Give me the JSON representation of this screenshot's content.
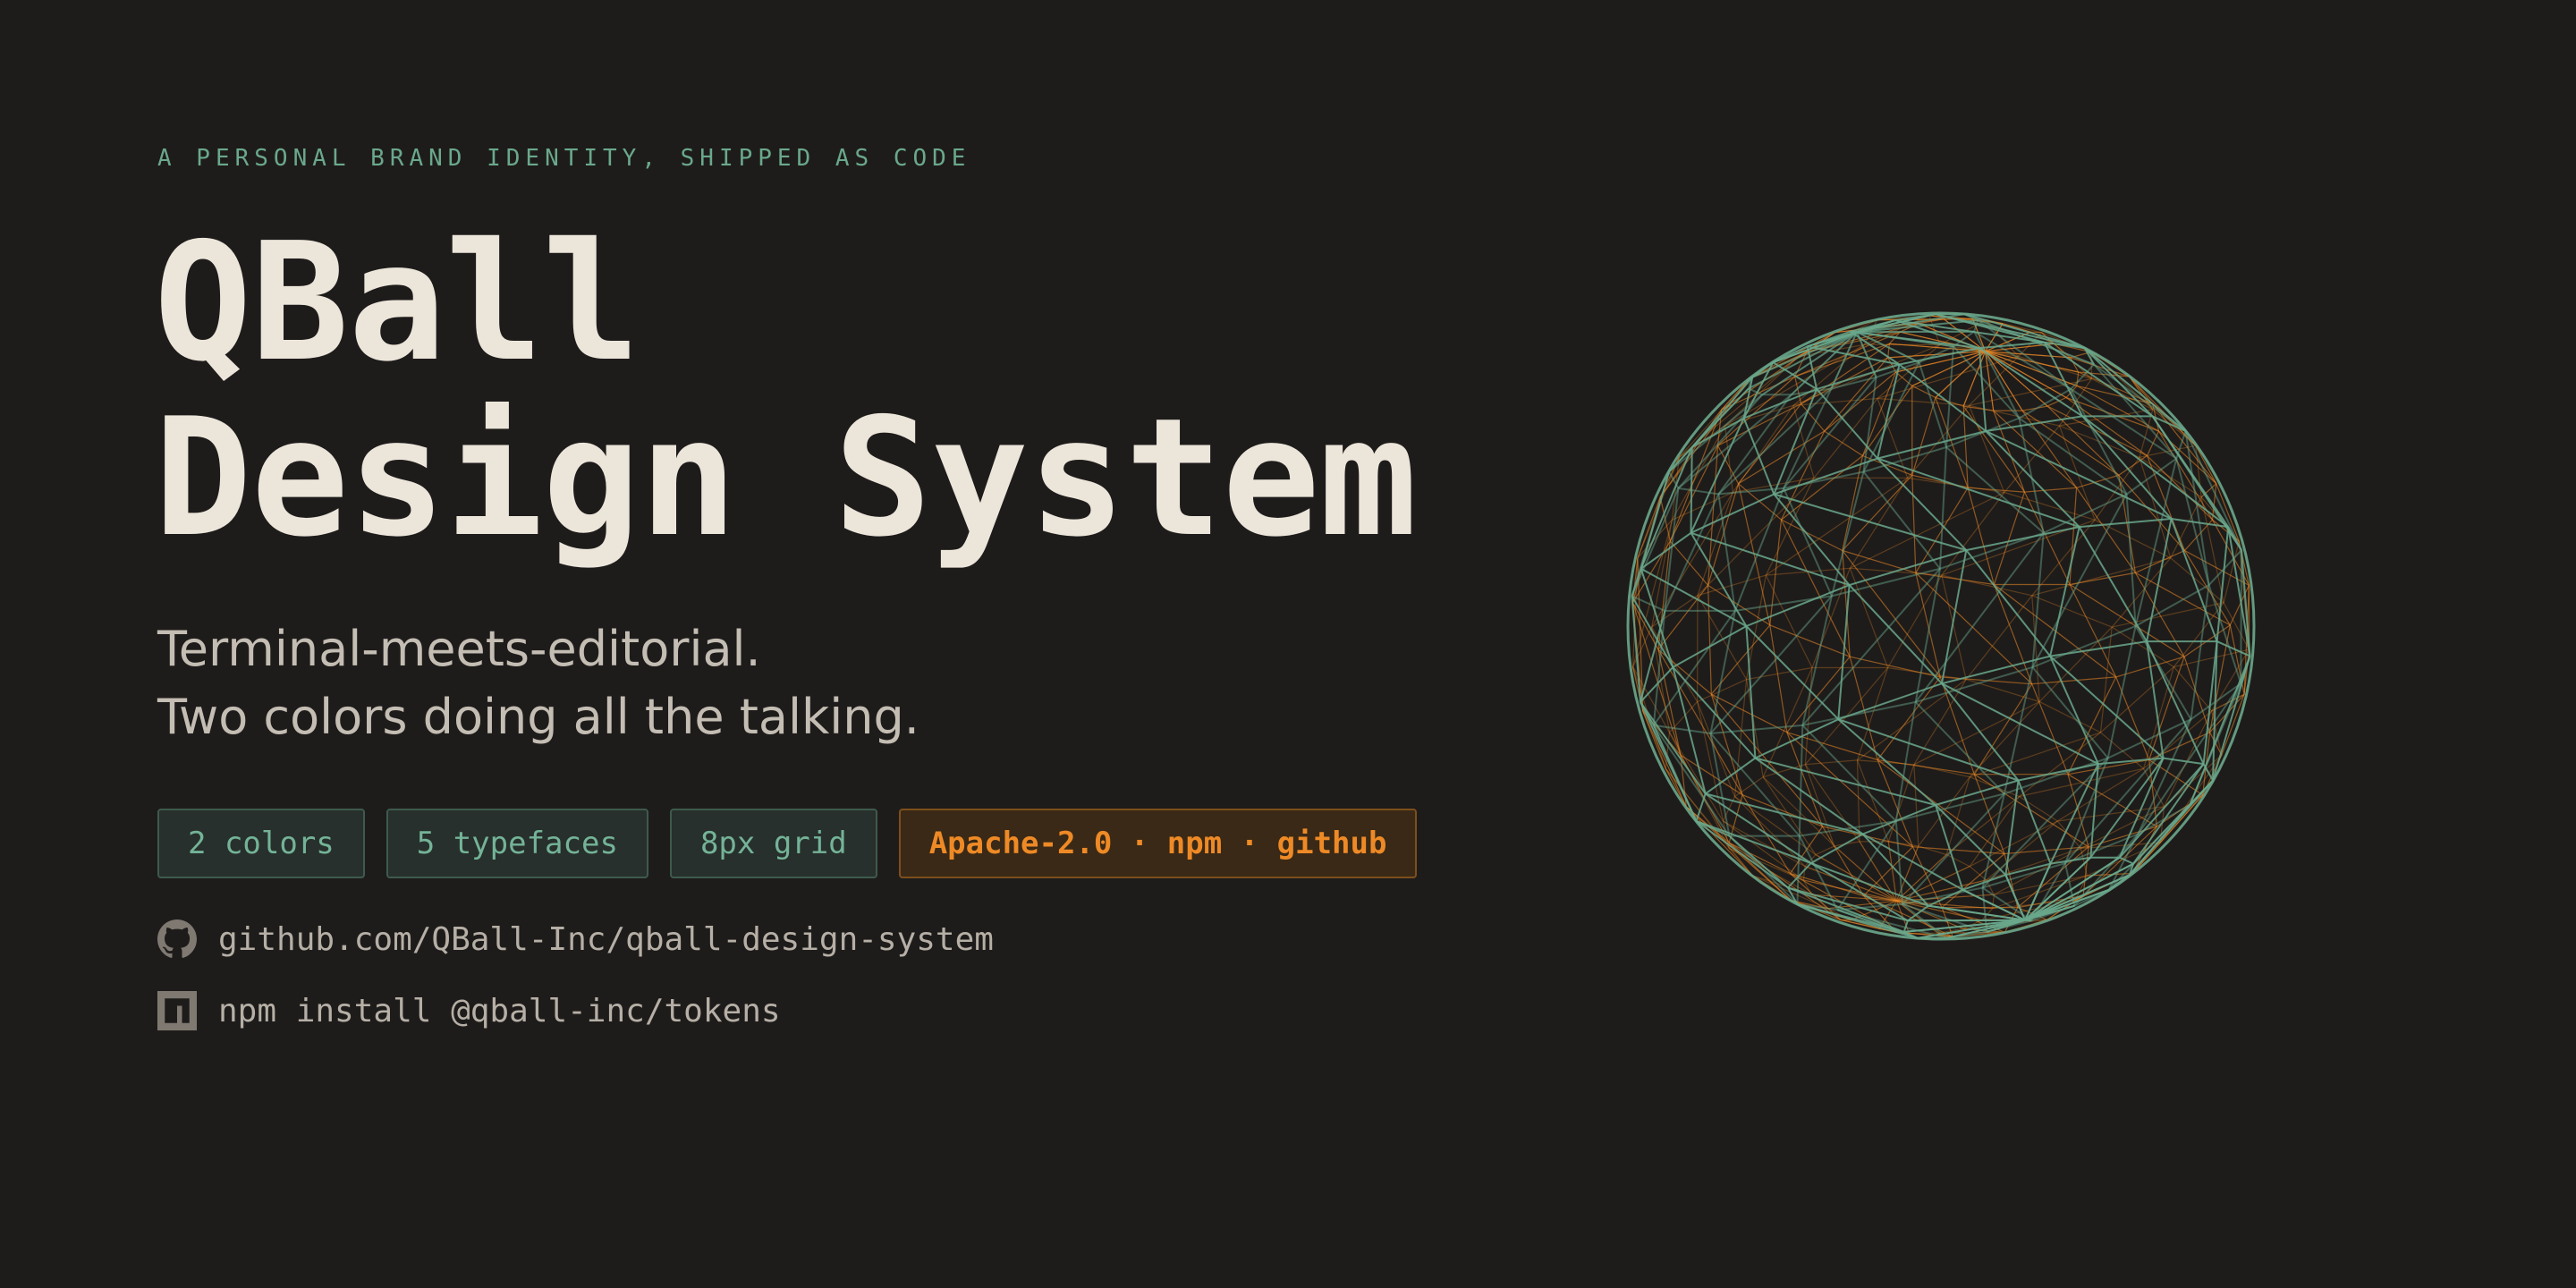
{
  "hero": {
    "eyebrow": "A PERSONAL BRAND IDENTITY, SHIPPED AS CODE",
    "title_line_1": "QBall",
    "title_line_2": "Design System",
    "tagline_line_1": "Terminal-meets-editorial.",
    "tagline_line_2": "Two colors doing all the talking."
  },
  "chips": [
    {
      "label": "2 colors"
    },
    {
      "label": "5 typefaces"
    },
    {
      "label": "8px grid"
    },
    {
      "label": "Apache-2.0 · npm · github"
    }
  ],
  "links": {
    "github": {
      "icon": "github-icon",
      "text": "github.com/QBall-Inc/qball-design-system"
    },
    "npm": {
      "icon": "npm-icon",
      "text": "npm install @qball-inc/tokens"
    }
  },
  "colors": {
    "background": "#1e1c1b",
    "accent_green": "#6aa88c",
    "accent_orange": "#ee8a26",
    "text_primary": "#ece5da",
    "text_secondary": "#c4bdb3"
  },
  "graphic": {
    "icon": "wireframe-sphere-icon"
  }
}
